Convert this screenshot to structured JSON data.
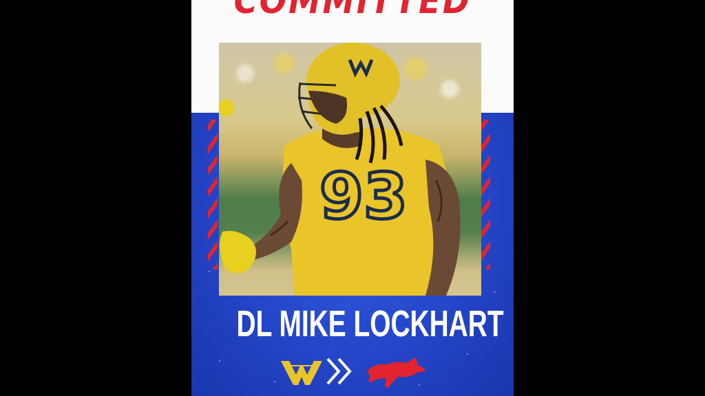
{
  "graphic": {
    "headline": "COMMITTED",
    "player_name": "DL MIKE LOCKHART",
    "jersey_number": "93",
    "colors": {
      "headline_red": "#e1242f",
      "background_blue": "#2446c9",
      "wvu_gold": "#eac52a",
      "wvu_navy": "#1c2c4c",
      "smu_red": "#e1242f"
    },
    "icons": {
      "from_logo": "wvu-flying-wv-logo",
      "transfer_arrow": "double-chevron-right-icon",
      "to_logo": "smu-mustang-logo"
    }
  }
}
